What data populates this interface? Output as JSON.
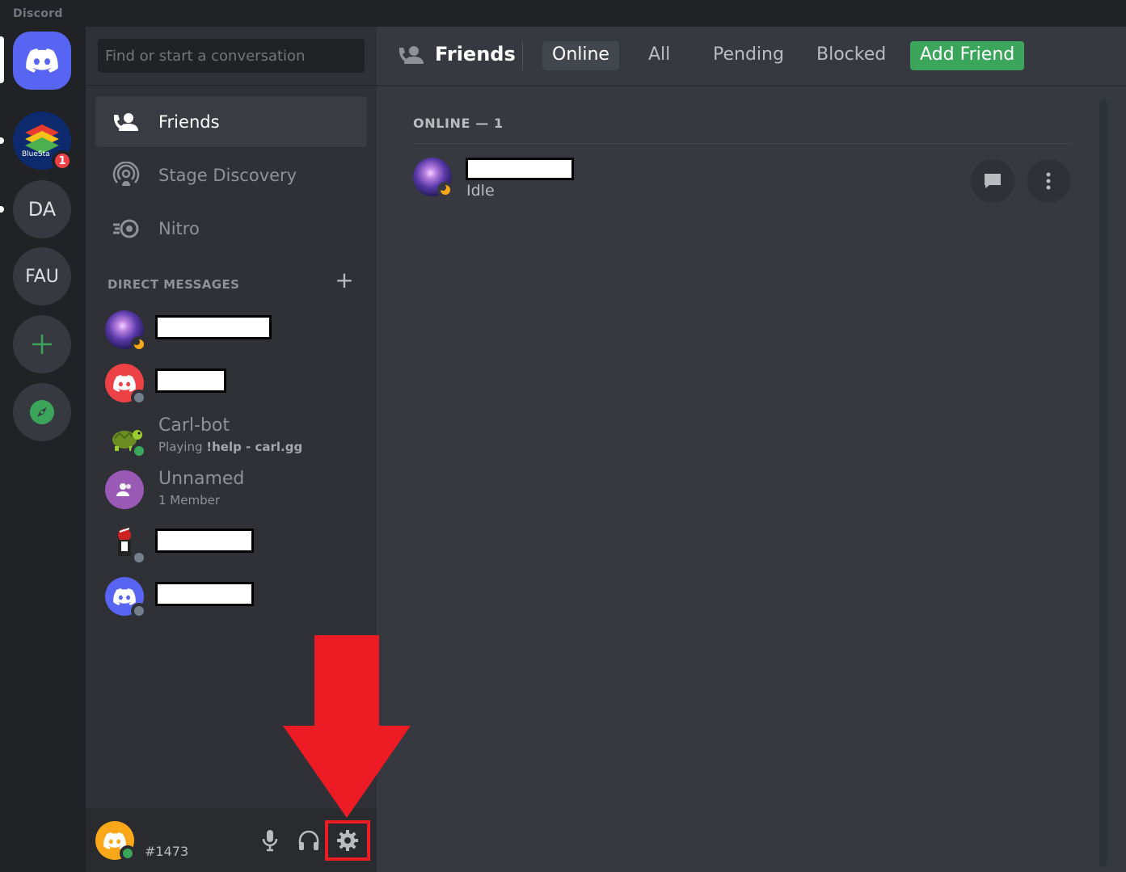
{
  "window": {
    "title": "Discord"
  },
  "servers": [
    {
      "name": "BlueStacks",
      "short": "BlueSta",
      "badge": "1"
    },
    {
      "name": "DA",
      "label": "DA"
    },
    {
      "name": "FAU",
      "label": "FAU"
    }
  ],
  "sidebar": {
    "search_placeholder": "Find or start a conversation",
    "nav": [
      {
        "label": "Friends"
      },
      {
        "label": "Stage Discovery"
      },
      {
        "label": "Nitro"
      }
    ],
    "dm_header": "DIRECT MESSAGES",
    "dms": [
      {
        "name": "",
        "redacted": true,
        "status": "idle"
      },
      {
        "name": "",
        "redacted": true,
        "status": "offline"
      },
      {
        "name": "Carl-bot",
        "sub_prefix": "Playing ",
        "sub_bold": "!help - carl.gg",
        "status": "online"
      },
      {
        "name": "Unnamed",
        "sub": "1 Member"
      },
      {
        "name": "",
        "redacted": true,
        "status": "offline"
      },
      {
        "name": "",
        "redacted": true,
        "status": "offline"
      }
    ]
  },
  "user": {
    "tag": "#1473",
    "status": "online"
  },
  "main": {
    "title": "Friends",
    "tabs": [
      "Online",
      "All",
      "Pending",
      "Blocked"
    ],
    "add_friend": "Add Friend",
    "section_header": "ONLINE — 1",
    "friends": [
      {
        "name": "",
        "redacted": true,
        "status_text": "Idle"
      }
    ]
  },
  "colors": {
    "blurple": "#5865f2",
    "green": "#3ba55c",
    "idle": "#faa81a",
    "red_annotation": "#ed1c24"
  }
}
